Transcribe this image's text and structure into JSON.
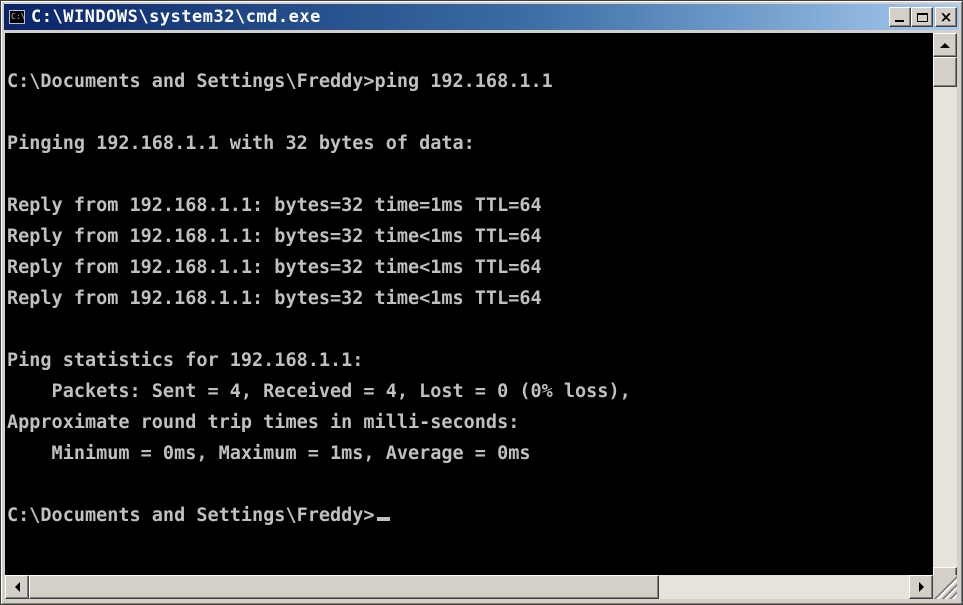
{
  "window": {
    "title": "C:\\WINDOWS\\system32\\cmd.exe",
    "icon": "console-icon",
    "icon_glyph": "C:\\"
  },
  "title_buttons": {
    "close_glyph": "×"
  },
  "console": {
    "text": "\nC:\\Documents and Settings\\Freddy>ping 192.168.1.1\n\nPinging 192.168.1.1 with 32 bytes of data:\n\nReply from 192.168.1.1: bytes=32 time=1ms TTL=64\nReply from 192.168.1.1: bytes=32 time<1ms TTL=64\nReply from 192.168.1.1: bytes=32 time<1ms TTL=64\nReply from 192.168.1.1: bytes=32 time<1ms TTL=64\n\nPing statistics for 192.168.1.1:\n    Packets: Sent = 4, Received = 4, Lost = 0 (0% loss),\nApproximate round trip times in milli-seconds:\n    Minimum = 0ms, Maximum = 1ms, Average = 0ms\n\nC:\\Documents and Settings\\Freddy>",
    "background_color": "#000000",
    "text_color": "#c0c0c0"
  },
  "colors": {
    "titlebar_start": "#0a246a",
    "titlebar_end": "#a6caf0",
    "window_face": "#d4d0c8"
  }
}
